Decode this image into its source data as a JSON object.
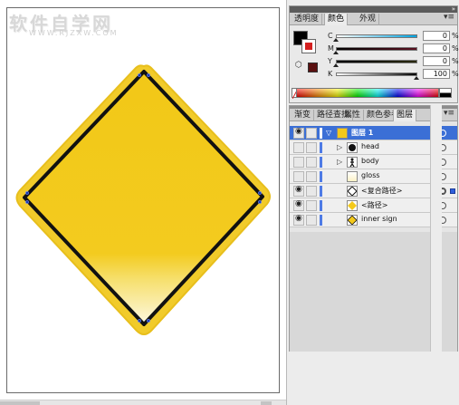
{
  "workspace": {
    "watermark_text": "软件自学网",
    "watermark_url": "WWW.RJZXW.COM"
  },
  "color_panel": {
    "tabs": [
      "透明度",
      "颜色",
      "外观"
    ],
    "active_tab": "颜色",
    "menu_icon": "panel-menu-icon",
    "sliders": [
      {
        "label": "C",
        "value": "0",
        "unit": "%"
      },
      {
        "label": "M",
        "value": "0",
        "unit": "%"
      },
      {
        "label": "Y",
        "value": "0",
        "unit": "%"
      },
      {
        "label": "K",
        "value": "100",
        "unit": "%"
      }
    ],
    "fill_color": "#000000",
    "stroke_color": "#ffffff"
  },
  "layers_panel": {
    "tabs": [
      "渐变",
      "路径查找",
      "属性",
      "颜色参考",
      "图层"
    ],
    "active_tab": "图层",
    "rows": [
      {
        "name": "图层 1",
        "visible": true,
        "expanded": true,
        "selected": true,
        "icon": "layer-thumb-icon"
      },
      {
        "name": "head",
        "visible": false,
        "expanded": false,
        "icon": "head-thumb-icon"
      },
      {
        "name": "body",
        "visible": false,
        "expanded": false,
        "icon": "body-thumb-icon"
      },
      {
        "name": "gloss",
        "visible": false,
        "icon": "gloss-thumb-icon"
      },
      {
        "name": "<复合路径>",
        "visible": true,
        "icon": "compound-path-thumb-icon"
      },
      {
        "name": "<路径>",
        "visible": true,
        "icon": "path-thumb-icon"
      },
      {
        "name": "inner sign",
        "visible": true,
        "icon": "inner-sign-thumb-icon"
      }
    ]
  },
  "colors": {
    "sign_yellow": "#f4c91a",
    "sign_border": "#111111",
    "selection_blue": "#3b6fd6"
  }
}
